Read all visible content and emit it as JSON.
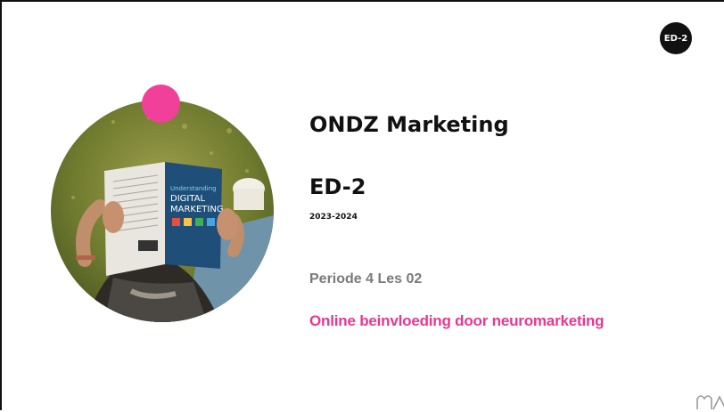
{
  "badge": {
    "label": "ED-2"
  },
  "slide": {
    "title": "ONDZ Marketing",
    "code": "ED-2",
    "year": "2023-2024",
    "periode": "Periode 4 Les 02",
    "subject": "Online beinvloeding door neuromarketing"
  },
  "photo": {
    "book_lines": [
      "Understanding",
      "DIGITAL",
      "MARKETING"
    ]
  },
  "colors": {
    "accent": "#e8378f",
    "dot": "#f0409a",
    "badge": "#111111",
    "muted": "#7a7a7a"
  }
}
